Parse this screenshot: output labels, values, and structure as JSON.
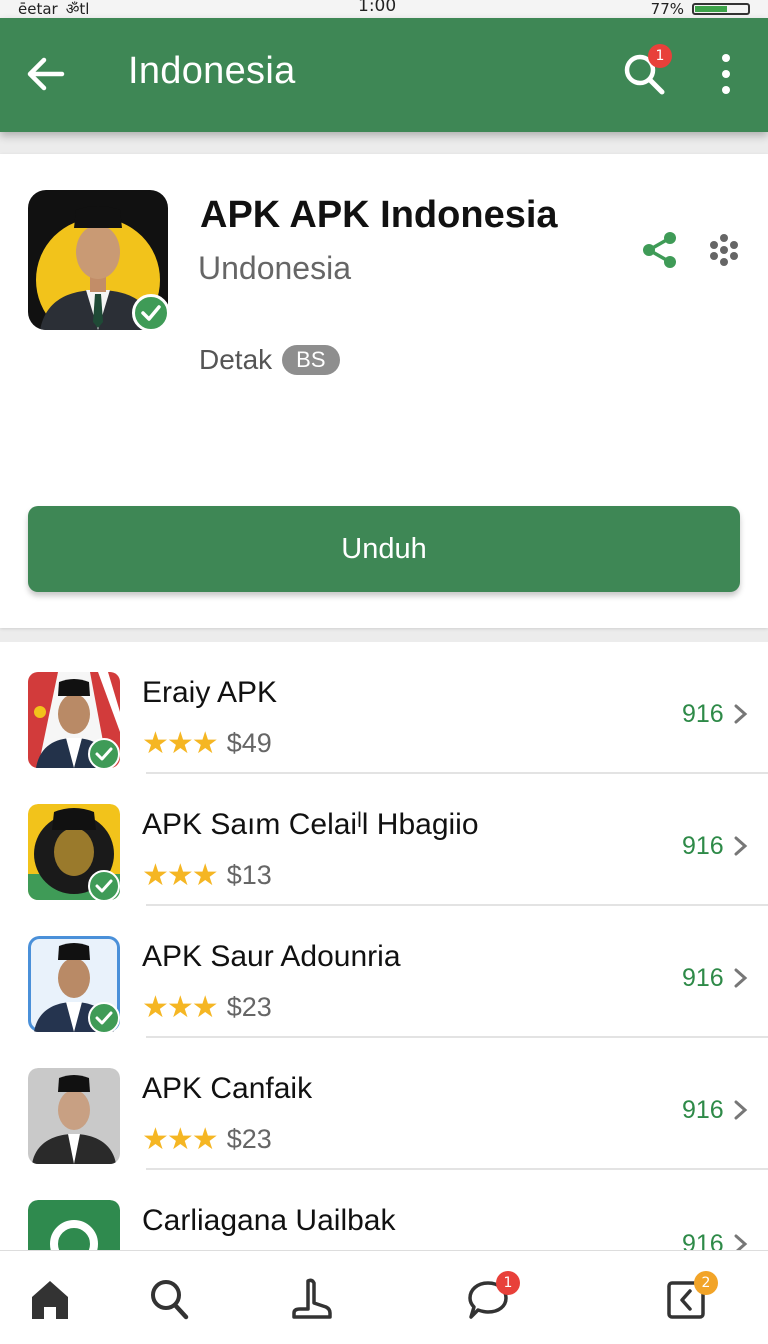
{
  "status_bar": {
    "carrier": "ēetar",
    "network": "ॐtl",
    "time": "1:00",
    "battery": "77%"
  },
  "app_bar": {
    "title": "Indonesia",
    "search_badge": "1",
    "color": "#3e8755"
  },
  "detail": {
    "title": "APK APK Indonesia",
    "subtitle": "Undonesia",
    "meta_label": "Detak",
    "meta_pill": "BS",
    "download_label": "Unduh",
    "icon_bg": "#f2c31b"
  },
  "list": [
    {
      "title": "Eraiy  APK",
      "stars": "★★★",
      "price": "$49",
      "count": "916"
    },
    {
      "title": "APK Saım Celaiˡl Hbagiio",
      "stars": "★★★",
      "price": "$13",
      "count": "916"
    },
    {
      "title": "APK Saur Adounria",
      "stars": "★★★",
      "price": "$23",
      "count": "916"
    },
    {
      "title": "APK Canfaik",
      "stars": "★★★",
      "price": "$23",
      "count": "916"
    },
    {
      "title": "Carliagana Uailbak",
      "stars": "",
      "price": "",
      "count": "916"
    }
  ],
  "bottom_nav": {
    "items": [
      "home-icon",
      "search-icon",
      "hand-icon",
      "chat-icon",
      "inbox-icon"
    ],
    "chat_badge": "1",
    "inbox_badge": "2"
  },
  "colors": {
    "accent": "#3e8755",
    "star": "#f5b623",
    "count": "#2e8a48",
    "badge_red": "#e8403a",
    "badge_orange": "#f2a428"
  }
}
